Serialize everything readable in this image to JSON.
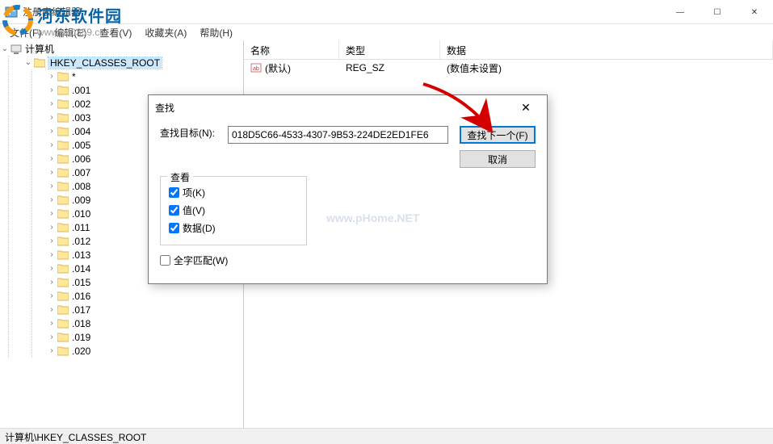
{
  "window": {
    "title": "注册表编辑器",
    "min": "—",
    "max": "☐",
    "close": "✕"
  },
  "menu": {
    "file": "文件(F)",
    "edit": "编辑(E)",
    "view": "查看(V)",
    "favorites": "收藏夹(A)",
    "help": "帮助(H)"
  },
  "tree": {
    "root": "计算机",
    "hkcr": "HKEY_CLASSES_ROOT",
    "items": [
      "*",
      ".001",
      ".002",
      ".003",
      ".004",
      ".005",
      ".006",
      ".007",
      ".008",
      ".009",
      ".010",
      ".011",
      ".012",
      ".013",
      ".014",
      ".015",
      ".016",
      ".017",
      ".018",
      ".019",
      ".020"
    ]
  },
  "list": {
    "headers": {
      "name": "名称",
      "type": "类型",
      "data": "数据"
    },
    "rows": [
      {
        "name": "(默认)",
        "type": "REG_SZ",
        "data": "(数值未设置)"
      }
    ]
  },
  "dialog": {
    "title": "查找",
    "target_label": "查找目标(N):",
    "target_value": "018D5C66-4533-4307-9B53-224DE2ED1FE6",
    "group_title": "查看",
    "chk_keys": "项(K)",
    "chk_values": "值(V)",
    "chk_data": "数据(D)",
    "chk_whole": "全字匹配(W)",
    "btn_find": "查找下一个(F)",
    "btn_cancel": "取消",
    "close": "✕"
  },
  "statusbar": "计算机\\HKEY_CLASSES_ROOT",
  "watermark": {
    "cn": "河东软件园",
    "url": "www.pc0359.cn",
    "center": "www.pHome.NET"
  }
}
